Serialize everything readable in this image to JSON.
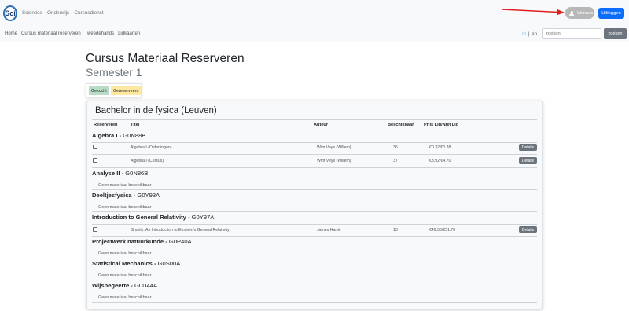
{
  "topnav": {
    "logo_text": "Sci",
    "links": [
      "Scientica",
      "Onderwijs",
      "Cursusdienst"
    ],
    "user_name": "Wannes",
    "logout_label": "Uitloggen"
  },
  "subnav": {
    "links": [
      "Home",
      "Cursus materiaal reserveren",
      "Tweedehands",
      "Lidkaarten"
    ],
    "lang_nl": "nl",
    "lang_sep": "|",
    "lang_en": "en",
    "search_placeholder": "zoeken",
    "search_label": "zoeken"
  },
  "page": {
    "title": "Cursus Materiaal Reserveren",
    "subtitle": "Semester 1",
    "legend_bought": "Gekocht",
    "legend_reserved": "Gereserveerd",
    "legend_bought_color": "#b9dcc4",
    "legend_reserved_color": "#ffe8a1"
  },
  "card": {
    "title": "Bachelor in de fysica (Leuven)",
    "columns": [
      "Reserveren",
      "Titel",
      "Auteur",
      "Beschikbaar",
      "Prijs Lid/Niet Lid"
    ],
    "details_label": "Details",
    "empty_label": "Geen materiaal beschikbaar",
    "courses": [
      {
        "name": "Algebra I",
        "code": "G0N88B",
        "items": [
          {
            "title": "Algebra I (Oefeningen)",
            "author": "Wim Veys (Willem)",
            "available": "36",
            "price": "€0.32/€0.38"
          },
          {
            "title": "Algebra I (Cursus)",
            "author": "Wim Veys (Willem)",
            "available": "37",
            "price": "€3.92/€4.70"
          }
        ]
      },
      {
        "name": "Analyse II",
        "code": "G0N86B",
        "items": []
      },
      {
        "name": "Deeltjesfysica",
        "code": "G0Y93A",
        "items": []
      },
      {
        "name": "Introduction to General Relativity",
        "code": "G0Y97A",
        "items": [
          {
            "title": "Gravity: An Introduction to Einstein's General Relativity",
            "author": "James Hartle",
            "available": "13",
            "price": "€49.50/€51.70"
          }
        ]
      },
      {
        "name": "Projectwerk natuurkunde",
        "code": "G0P40A",
        "items": []
      },
      {
        "name": "Statistical Mechanics",
        "code": "G0S00A",
        "items": []
      },
      {
        "name": "Wijsbegeerte",
        "code": "G0U44A",
        "items": []
      }
    ]
  }
}
